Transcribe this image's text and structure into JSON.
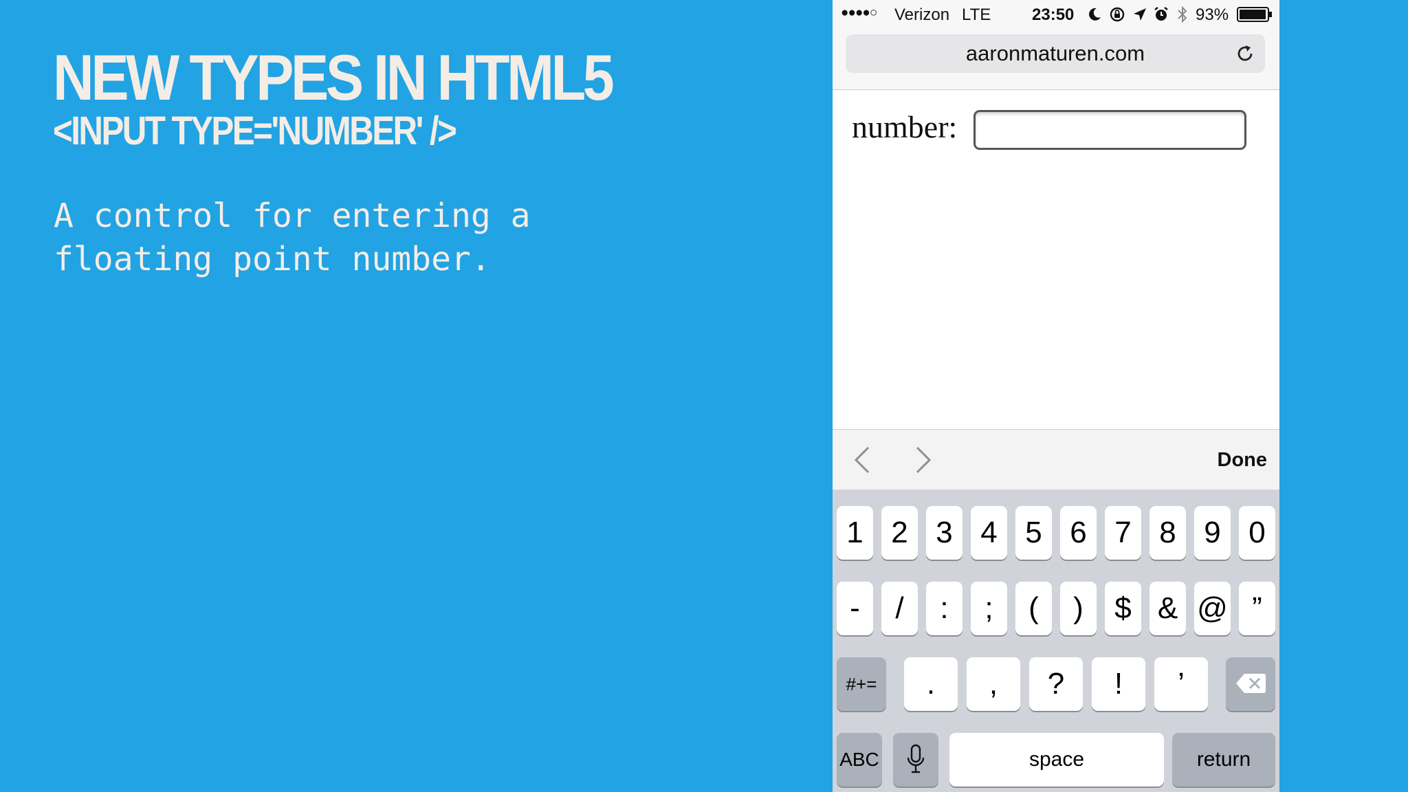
{
  "slide": {
    "title": "NEW TYPES IN HTML5",
    "subtitle": "<INPUT TYPE='NUMBER' />",
    "description_line1": "A control for entering a",
    "description_line2": "floating point number."
  },
  "status_bar": {
    "signal": "●●●●○",
    "carrier": "Verizon",
    "network": "LTE",
    "time": "23:50",
    "battery": "93%",
    "icons": [
      "moon-icon",
      "orientation-lock-icon",
      "location-icon",
      "alarm-icon",
      "bluetooth-icon",
      "battery-icon"
    ]
  },
  "browser": {
    "url": "aaronmaturen.com",
    "reload_icon": "reload-icon"
  },
  "form": {
    "label": "number:",
    "value": "",
    "placeholder": ""
  },
  "accessory": {
    "prev_icon": "chevron-left-icon",
    "next_icon": "chevron-right-icon",
    "done": "Done"
  },
  "keyboard": {
    "row1": [
      "1",
      "2",
      "3",
      "4",
      "5",
      "6",
      "7",
      "8",
      "9",
      "0"
    ],
    "row2": [
      "-",
      "/",
      ":",
      ";",
      "(",
      ")",
      "$",
      "&",
      "@",
      "”"
    ],
    "row3_shift": "#+=",
    "row3": [
      ".",
      ",",
      "?",
      "!",
      "’"
    ],
    "row3_delete_icon": "delete-icon",
    "abc": "ABC",
    "mic_icon": "microphone-icon",
    "space": "space",
    "return": "return"
  },
  "colors": {
    "background": "#22a3e3",
    "slide_text": "#f4ede6",
    "keyboard": "#d0d3d9",
    "key": "#ffffff",
    "function_key": "#abb1ba"
  }
}
